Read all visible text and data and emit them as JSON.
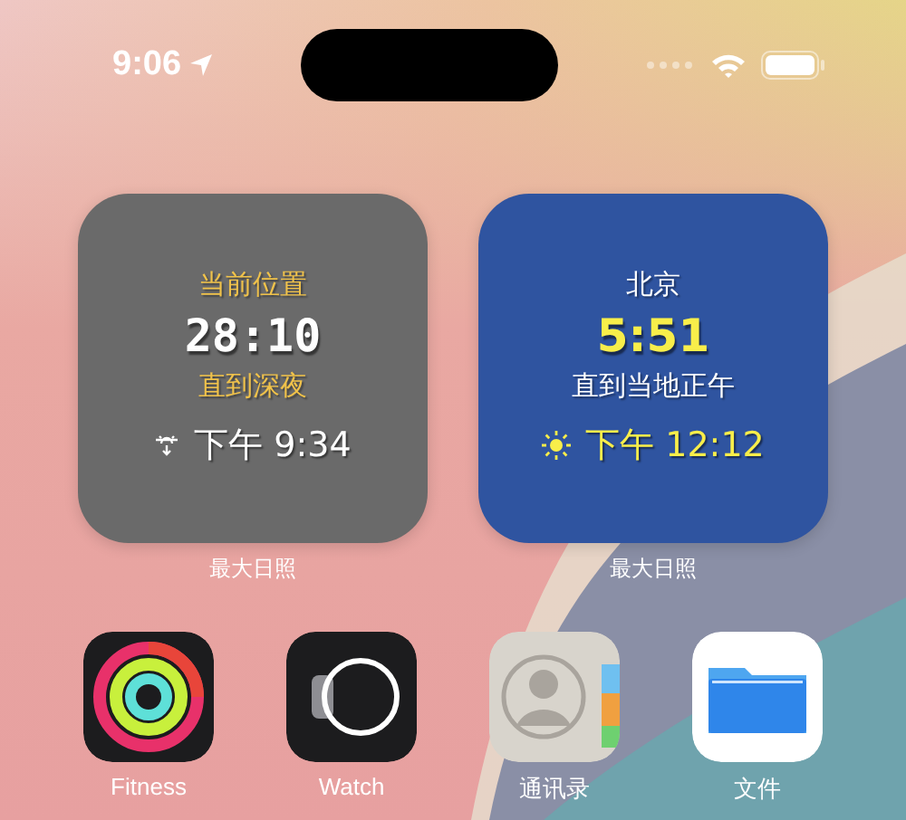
{
  "status_bar": {
    "time": "9:06"
  },
  "widgets": [
    {
      "kind": "night",
      "title": "当前位置",
      "value": "28:10",
      "caption": "直到深夜",
      "event_time": "下午 9:34",
      "label": "最大日照"
    },
    {
      "kind": "day",
      "title": "北京",
      "value": "5:51",
      "caption": "直到当地正午",
      "event_time": "下午 12:12",
      "label": "最大日照"
    }
  ],
  "apps": [
    {
      "kind": "fitness",
      "label": "Fitness"
    },
    {
      "kind": "watch",
      "label": "Watch"
    },
    {
      "kind": "contacts",
      "label": "通讯录"
    },
    {
      "kind": "files",
      "label": "文件"
    }
  ]
}
